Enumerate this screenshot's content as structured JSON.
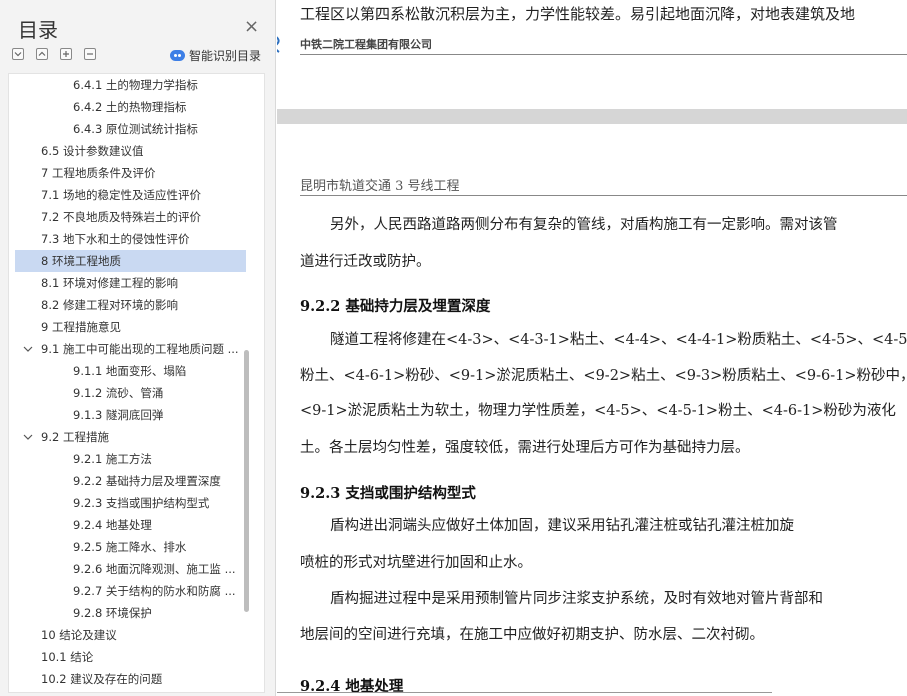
{
  "toc_panel": {
    "title": "目录",
    "close_glyph": "×",
    "smart_label": "智能识别目录",
    "items": [
      {
        "label": "6.4.1 土的物理力学指标",
        "level": 3
      },
      {
        "label": "6.4.2 土的热物理指标",
        "level": 3
      },
      {
        "label": "6.4.3 原位测试统计指标",
        "level": 3
      },
      {
        "label": "6.5 设计参数建议值",
        "level": 2
      },
      {
        "label": "7 工程地质条件及评价",
        "level": 1
      },
      {
        "label": "7.1 场地的稳定性及适应性评价",
        "level": 2
      },
      {
        "label": "7.2 不良地质及特殊岩土的评价",
        "level": 2
      },
      {
        "label": "7.3 地下水和土的侵蚀性评价",
        "level": 2
      },
      {
        "label": "8 环境工程地质",
        "level": 1,
        "selected": true
      },
      {
        "label": "8.1 环境对修建工程的影响",
        "level": 2
      },
      {
        "label": "8.2 修建工程对环境的影响",
        "level": 2
      },
      {
        "label": "9 工程措施意见",
        "level": 1
      },
      {
        "label": "9.1 施工中可能出现的工程地质问题 ...",
        "level": 2,
        "expanded": true
      },
      {
        "label": "9.1.1 地面变形、塌陷",
        "level": 3
      },
      {
        "label": "9.1.2 流砂、管涌",
        "level": 3
      },
      {
        "label": "9.1.3 隧洞底回弹",
        "level": 3
      },
      {
        "label": "9.2 工程措施",
        "level": 2,
        "expanded": true
      },
      {
        "label": "9.2.1 施工方法",
        "level": 3
      },
      {
        "label": "9.2.2 基础持力层及埋置深度",
        "level": 3
      },
      {
        "label": "9.2.3 支挡或围护结构型式",
        "level": 3
      },
      {
        "label": "9.2.4 地基处理",
        "level": 3
      },
      {
        "label": "9.2.5 施工降水、排水",
        "level": 3
      },
      {
        "label": "9.2.6 地面沉降观测、施工监 ...",
        "level": 3
      },
      {
        "label": "9.2.7 关于结构的防水和防腐 ...",
        "level": 3
      },
      {
        "label": "9.2.8 环境保护",
        "level": 3
      },
      {
        "label": "10 结论及建议",
        "level": 1
      },
      {
        "label": "10.1 结论",
        "level": 2
      },
      {
        "label": "10.2 建议及存在的问题",
        "level": 2
      }
    ]
  },
  "document": {
    "prev_page_tail": "工程区以第四系松散沉积层为主，力学性能较差。易引起地面沉降，对地表建筑及地",
    "company": "中铁二院工程集团有限公司",
    "project_header": "昆明市轨道交通 3 号线工程",
    "lines": [
      {
        "type": "p",
        "text": "另外，人民西路道路两侧分布有复杂的管线，对盾构施工有一定影响。需对该管",
        "indent": true
      },
      {
        "type": "p",
        "text": "道进行迁改或防护。"
      },
      {
        "type": "h",
        "text": "9.2.2 基础持力层及埋置深度"
      },
      {
        "type": "p",
        "text": "隧道工程将修建在<4-3>、<4-3-1>粘土、<4-4>、<4-4-1>粉质粘土、<4-5>、<4-5-1>",
        "indent": true
      },
      {
        "type": "p",
        "text": "粉土、<4-6-1>粉砂、<9-1>淤泥质粘土、<9-2>粘土、<9-3>粉质粘土、<9-6-1>粉砂中，"
      },
      {
        "type": "p",
        "text": "<9-1>淤泥质粘土为软土，物理力学性质差，<4-5>、<4-5-1>粉土、<4-6-1>粉砂为液化"
      },
      {
        "type": "p",
        "text": "土。各土层均匀性差，强度较低，需进行处理后方可作为基础持力层。"
      },
      {
        "type": "h",
        "text": "9.2.3 支挡或围护结构型式"
      },
      {
        "type": "p",
        "text": "盾构进出洞端头应做好土体加固，建议采用钻孔灌注桩或钻孔灌注桩加旋",
        "indent": true
      },
      {
        "type": "p",
        "text": "喷桩的形式对坑壁进行加固和止水。"
      },
      {
        "type": "p",
        "text": "盾构掘进过程中是采用预制管片同步注浆支护系统，及时有效地对管片背部和",
        "indent": true
      },
      {
        "type": "p",
        "text": "地层间的空间进行充填，在施工中应做好初期支护、防水层、二次衬砌。"
      },
      {
        "type": "h",
        "text": "9.2.4 地基处理"
      }
    ]
  },
  "colors": {
    "selected_bg": "#c9d9f2",
    "accent": "#3d7fe6"
  }
}
